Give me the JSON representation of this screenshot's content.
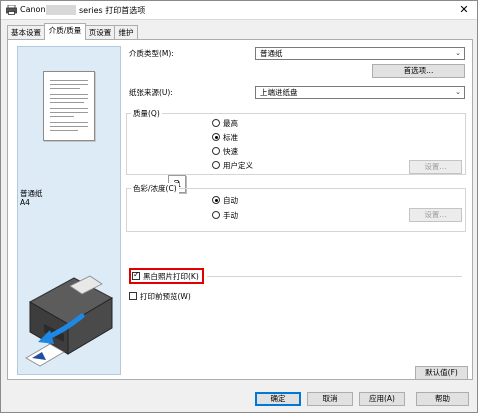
{
  "window": {
    "title_brand": "Canon",
    "title_rest": "series 打印首选项",
    "close_glyph": "✕"
  },
  "tabs": [
    {
      "label": "基本设置",
      "active": false
    },
    {
      "label": "介质/质量",
      "active": true
    },
    {
      "label": "页设置",
      "active": false
    },
    {
      "label": "维护",
      "active": false
    }
  ],
  "preview": {
    "media_name": "普通纸",
    "paper_size": "A4"
  },
  "media_type": {
    "label": "介质类型(M):",
    "value": "普通纸",
    "advanced_button": "首选项..."
  },
  "paper_source": {
    "label": "纸张来源(U):",
    "value": "上端进纸盘"
  },
  "quality": {
    "group_label": "质量(Q)",
    "icon_glyph": "a",
    "options": [
      {
        "label": "最高",
        "checked": false
      },
      {
        "label": "标准",
        "checked": true
      },
      {
        "label": "快速",
        "checked": false
      },
      {
        "label": "用户定义",
        "checked": false
      }
    ],
    "set_button": "设置..."
  },
  "color": {
    "group_label": "色彩/浓度(C)",
    "options": [
      {
        "label": "自动",
        "checked": true
      },
      {
        "label": "手动",
        "checked": false
      }
    ],
    "set_button": "设置..."
  },
  "grayscale": {
    "label": "黑白照片打印(K)",
    "checked": true
  },
  "preview_before_print": {
    "label": "打印前预览(W)",
    "checked": false
  },
  "defaults_button": "默认值(F)",
  "footer": {
    "ok": "确定",
    "cancel": "取消",
    "apply": "应用(A)",
    "help": "帮助"
  },
  "colors": {
    "highlight_border": "#e00000",
    "default_button_border": "#0078d7",
    "preview_background": "#ddebf7"
  }
}
